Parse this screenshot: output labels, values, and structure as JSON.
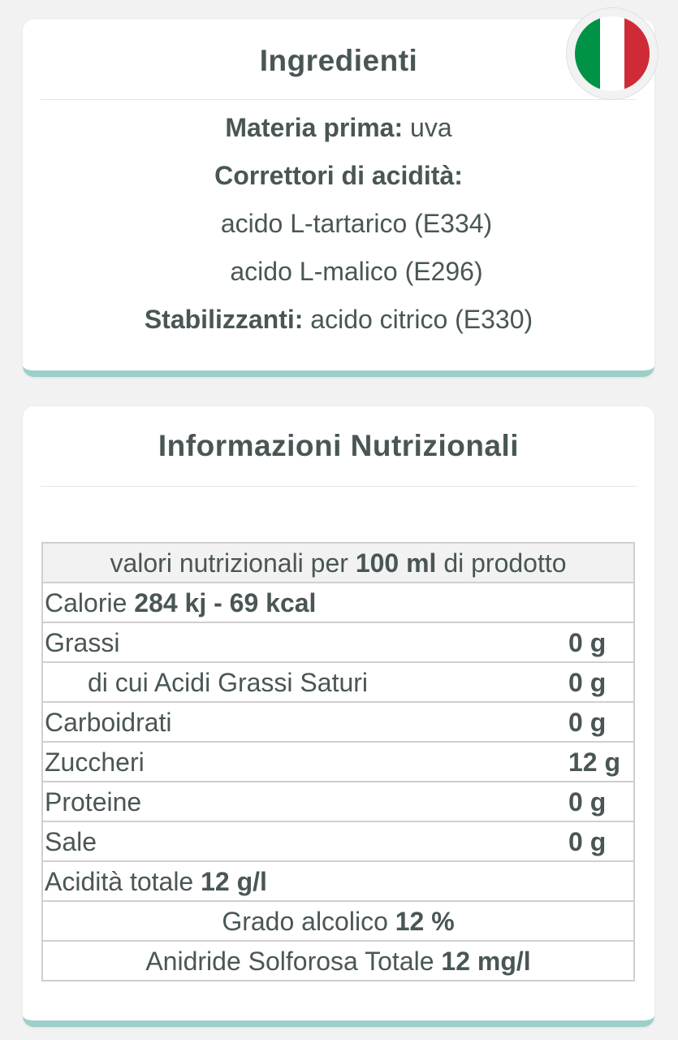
{
  "ingredients": {
    "title": "Ingredienti",
    "flag_colors": [
      "#009246",
      "#ffffff",
      "#ce2b37"
    ],
    "raw_material_label": "Materia prima:",
    "raw_material_value": " uva",
    "acidity_label": "Correttori di acidità:",
    "acidity_items": [
      "acido L-tartarico (E334)",
      "acido L-malico (E296)"
    ],
    "stabilizers_label": "Stabilizzanti:",
    "stabilizers_value": " acido citrico (E330)"
  },
  "nutrition": {
    "title": "Informazioni Nutrizionali",
    "header_prefix": "valori nutrizionali per ",
    "header_bold": "100 ml",
    "header_suffix": " di prodotto",
    "calories_label": "Calorie ",
    "calories_value": "284 kj - 69 kcal",
    "rows": [
      {
        "label": "Grassi",
        "value": "0 g"
      },
      {
        "label": "di cui Acidi Grassi Saturi",
        "value": "0 g"
      },
      {
        "label": "Carboidrati",
        "value": "0 g"
      },
      {
        "label": "Zuccheri",
        "value": "12 g"
      },
      {
        "label": "Proteine",
        "value": "0 g"
      },
      {
        "label": "Sale",
        "value": "0 g"
      }
    ],
    "acidity_label": "Acidità totale ",
    "acidity_value": "12 g/l",
    "alcohol_label": "Grado alcolico ",
    "alcohol_value": "12 %",
    "sulfur_label": "Anidride Solforosa Totale ",
    "sulfur_value": "12 mg/l"
  }
}
